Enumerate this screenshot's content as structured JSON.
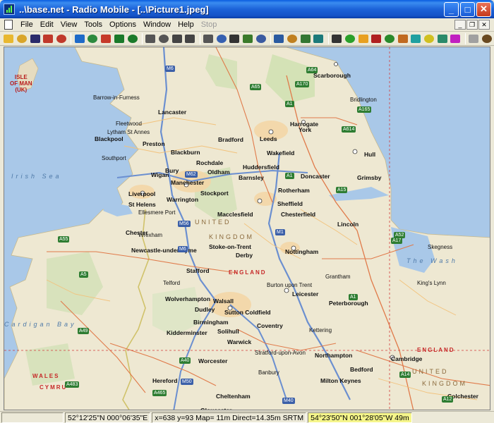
{
  "window": {
    "title": "..\\base.net - Radio Mobile - [..\\Picture1.jpeg]",
    "minimize_symbol": "_",
    "maximize_symbol": "□",
    "close_symbol": "✕"
  },
  "menu": {
    "items": [
      {
        "label": "File",
        "enabled": true
      },
      {
        "label": "Edit",
        "enabled": true
      },
      {
        "label": "View",
        "enabled": true
      },
      {
        "label": "Tools",
        "enabled": true
      },
      {
        "label": "Options",
        "enabled": true
      },
      {
        "label": "Window",
        "enabled": true
      },
      {
        "label": "Help",
        "enabled": true
      },
      {
        "label": "Stop",
        "enabled": false
      }
    ]
  },
  "toolbar": {
    "groups": [
      [
        "open-folder-icon",
        "open-file-icon",
        "save-icon",
        "network-properties-icon",
        "unit-properties-icon"
      ],
      [
        "world-icon",
        "globe-icon",
        "globe-alt-icon",
        "arrow-left-icon",
        "arrow-right-icon"
      ],
      [
        "window-icon",
        "window-restore-icon",
        "pdf-icon",
        "picture-icon"
      ],
      [
        "print-icon",
        "copy-icon",
        "merge-icon",
        "elevation-icon",
        "polygon-icon"
      ],
      [
        "map-properties-icon",
        "person-icon",
        "picture-properties-icon",
        "zoom-icon"
      ],
      [
        "antenna-icon",
        "radio-link-icon",
        "polar-coverage-icon",
        "cartesian-coverage-icon",
        "route-icon",
        "find-icon",
        "network-icon",
        "visual-icon",
        "stats-icon",
        "palette-icon"
      ],
      [
        "shortcut-icon",
        "help-icon"
      ]
    ],
    "colors": {
      "open-folder-icon": "#e8b830",
      "open-file-icon": "#d9a52a",
      "save-icon": "#2b2b6b",
      "network-properties-icon": "#c0392b",
      "unit-properties-icon": "#c0392b",
      "world-icon": "#1e6ac8",
      "globe-icon": "#2c8a3e",
      "globe-alt-icon": "#c63a2a",
      "arrow-left-icon": "#1a7a2a",
      "arrow-right-icon": "#1a7a2a",
      "window-icon": "#555555",
      "window-restore-icon": "#555555",
      "pdf-icon": "#444444",
      "picture-icon": "#444444",
      "print-icon": "#555555",
      "copy-icon": "#3660b0",
      "merge-icon": "#333333",
      "elevation-icon": "#3a7a2a",
      "polygon-icon": "#3a5aa0",
      "map-properties-icon": "#2a5aa0",
      "person-icon": "#c08020",
      "picture-properties-icon": "#337733",
      "zoom-icon": "#1c7a7a",
      "antenna-icon": "#333333",
      "radio-link-icon": "#2aa02a",
      "polar-coverage-icon": "#e8a020",
      "cartesian-coverage-icon": "#b02020",
      "route-icon": "#2a8a2a",
      "find-icon": "#c06a20",
      "network-icon": "#20a0a0",
      "visual-icon": "#d0c020",
      "stats-icon": "#2a8a6a",
      "palette-icon": "#c020c0",
      "shortcut-icon": "#a0a0a0",
      "help-icon": "#6a4a20"
    }
  },
  "map": {
    "places": [
      {
        "name": "Lancaster",
        "kind": "city"
      },
      {
        "name": "Scarborough",
        "kind": "city"
      },
      {
        "name": "Harrogate",
        "kind": "city"
      },
      {
        "name": "York",
        "kind": "city"
      },
      {
        "name": "Blackpool",
        "kind": "city"
      },
      {
        "name": "Preston",
        "kind": "city"
      },
      {
        "name": "Blackburn",
        "kind": "city"
      },
      {
        "name": "Leeds",
        "kind": "city"
      },
      {
        "name": "Bradford",
        "kind": "city"
      },
      {
        "name": "Wakefield",
        "kind": "city"
      },
      {
        "name": "Hull",
        "kind": "city"
      },
      {
        "name": "Bury",
        "kind": "city"
      },
      {
        "name": "Wigan",
        "kind": "city"
      },
      {
        "name": "Manchester",
        "kind": "city"
      },
      {
        "name": "Rochdale",
        "kind": "city"
      },
      {
        "name": "Oldham",
        "kind": "city"
      },
      {
        "name": "Huddersfield",
        "kind": "city"
      },
      {
        "name": "Barnsley",
        "kind": "city"
      },
      {
        "name": "Doncaster",
        "kind": "city"
      },
      {
        "name": "Grimsby",
        "kind": "city"
      },
      {
        "name": "Liverpool",
        "kind": "city"
      },
      {
        "name": "St Helens",
        "kind": "city"
      },
      {
        "name": "Warrington",
        "kind": "city"
      },
      {
        "name": "Stockport",
        "kind": "city"
      },
      {
        "name": "Rotherham",
        "kind": "city"
      },
      {
        "name": "Sheffield",
        "kind": "city"
      },
      {
        "name": "Chester",
        "kind": "city"
      },
      {
        "name": "Macclesfield",
        "kind": "city"
      },
      {
        "name": "Chesterfield",
        "kind": "city"
      },
      {
        "name": "Lincoln",
        "kind": "city"
      },
      {
        "name": "Newcastle-under-Lyme",
        "kind": "city"
      },
      {
        "name": "Stoke-on-Trent",
        "kind": "city"
      },
      {
        "name": "Derby",
        "kind": "city"
      },
      {
        "name": "Nottingham",
        "kind": "city"
      },
      {
        "name": "Stafford",
        "kind": "city"
      },
      {
        "name": "Leicester",
        "kind": "city"
      },
      {
        "name": "Wolverhampton",
        "kind": "city"
      },
      {
        "name": "Walsall",
        "kind": "city"
      },
      {
        "name": "Sutton Coldfield",
        "kind": "city"
      },
      {
        "name": "Dudley",
        "kind": "city"
      },
      {
        "name": "Birmingham",
        "kind": "city"
      },
      {
        "name": "Solihull",
        "kind": "city"
      },
      {
        "name": "Coventry",
        "kind": "city"
      },
      {
        "name": "Peterborough",
        "kind": "city"
      },
      {
        "name": "Kidderminster",
        "kind": "city"
      },
      {
        "name": "Warwick",
        "kind": "city"
      },
      {
        "name": "Worcester",
        "kind": "city"
      },
      {
        "name": "Northampton",
        "kind": "city"
      },
      {
        "name": "Cambridge",
        "kind": "city"
      },
      {
        "name": "Bedford",
        "kind": "city"
      },
      {
        "name": "Milton Keynes",
        "kind": "city"
      },
      {
        "name": "Hereford",
        "kind": "city"
      },
      {
        "name": "Cheltenham",
        "kind": "city"
      },
      {
        "name": "Gloucester",
        "kind": "city"
      },
      {
        "name": "Colchester",
        "kind": "city"
      },
      {
        "name": "Lytham St Annes",
        "kind": "town"
      },
      {
        "name": "Southport",
        "kind": "town"
      },
      {
        "name": "Barrow-in-Furness",
        "kind": "town"
      },
      {
        "name": "Ellesmere Port",
        "kind": "town"
      },
      {
        "name": "Burton upon Trent",
        "kind": "town"
      },
      {
        "name": "King's Lynn",
        "kind": "town"
      },
      {
        "name": "Stratford-upon-Avon",
        "kind": "town"
      },
      {
        "name": "Banbury",
        "kind": "town"
      },
      {
        "name": "Wrexham",
        "kind": "town"
      },
      {
        "name": "Telford",
        "kind": "town"
      },
      {
        "name": "Grantham",
        "kind": "town"
      },
      {
        "name": "Skegness",
        "kind": "town"
      },
      {
        "name": "Kettering",
        "kind": "town"
      },
      {
        "name": "Bridlington",
        "kind": "town"
      },
      {
        "name": "Fleetwood",
        "kind": "town"
      }
    ],
    "regions": [
      {
        "name": "UNITED",
        "kind": "region"
      },
      {
        "name": "KINGDOM",
        "kind": "region"
      },
      {
        "name": "UNITED",
        "kind": "region"
      },
      {
        "name": "KINGDOM",
        "kind": "region"
      },
      {
        "name": "ENGLAND",
        "kind": "country"
      },
      {
        "name": "ENGLAND",
        "kind": "country"
      },
      {
        "name": "WALES",
        "kind": "country"
      },
      {
        "name": "CYMRU",
        "kind": "country"
      }
    ],
    "water": [
      {
        "name": "Irish Sea"
      },
      {
        "name": "The Wash"
      },
      {
        "name": "Cardigan Bay"
      }
    ],
    "isle": {
      "line1": "ISLE",
      "line2": "OF MAN",
      "line3": "(UK)"
    },
    "shields": [
      {
        "label": "M6",
        "type": "m"
      },
      {
        "label": "M62",
        "type": "m"
      },
      {
        "label": "M56",
        "type": "m"
      },
      {
        "label": "M6",
        "type": "m"
      },
      {
        "label": "M1",
        "type": "m"
      },
      {
        "label": "M50",
        "type": "m"
      },
      {
        "label": "M40",
        "type": "m"
      },
      {
        "label": "A64",
        "type": "a"
      },
      {
        "label": "A1",
        "type": "a"
      },
      {
        "label": "A165",
        "type": "a"
      },
      {
        "label": "A614",
        "type": "a"
      },
      {
        "label": "A15",
        "type": "a"
      },
      {
        "label": "A17",
        "type": "a"
      },
      {
        "label": "A1",
        "type": "a"
      },
      {
        "label": "A14",
        "type": "a"
      },
      {
        "label": "A12",
        "type": "a"
      },
      {
        "label": "A40",
        "type": "a"
      },
      {
        "label": "A55",
        "type": "a"
      },
      {
        "label": "A5",
        "type": "a"
      },
      {
        "label": "A49",
        "type": "a"
      },
      {
        "label": "A65",
        "type": "a"
      },
      {
        "label": "A170",
        "type": "a"
      },
      {
        "label": "A52",
        "type": "a"
      },
      {
        "label": "A483",
        "type": "a"
      },
      {
        "label": "A465",
        "type": "a"
      },
      {
        "label": "A1",
        "type": "a"
      }
    ]
  },
  "status": {
    "lat_lon": "52°12'25\"N 000°06'35\"E",
    "cursor_info": "x=638 y=93 Map= 11m Direct=14.35m SRTM",
    "cursor_latlon": "54°23'50\"N 001°28'05\"W 49m"
  }
}
